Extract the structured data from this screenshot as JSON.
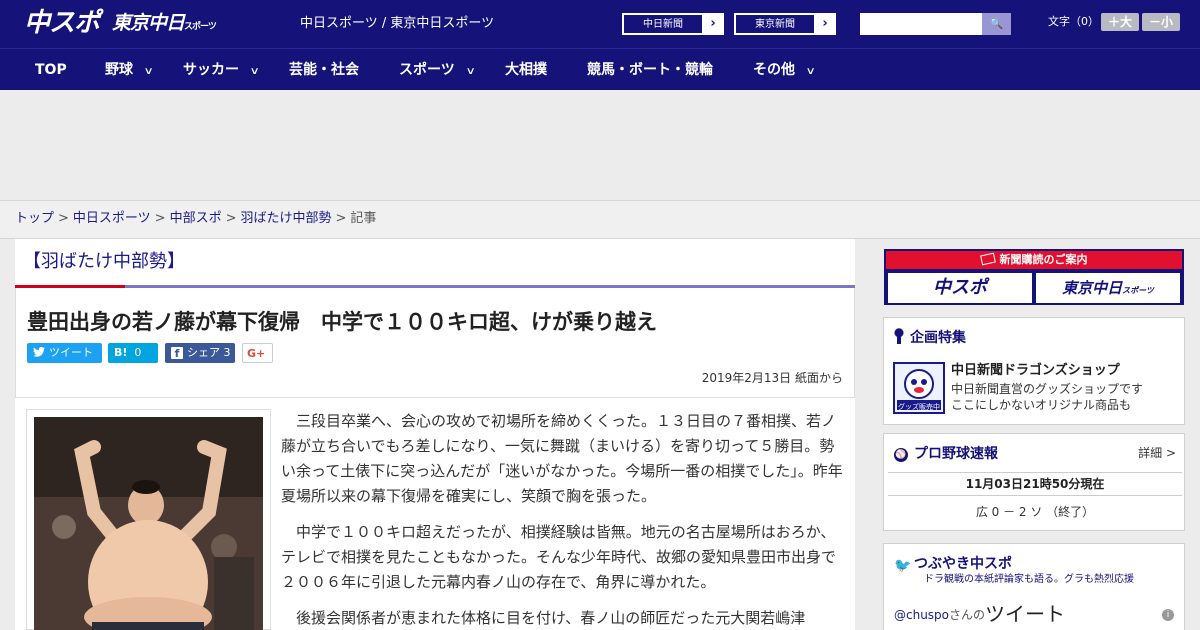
{
  "header": {
    "logo_main": "中スポ",
    "logo_tokyo": "東京中日",
    "logo_tokyo_small": "スポーツ",
    "site_link": "中日スポーツ / 東京中日スポーツ",
    "paper_buttons": [
      {
        "label": "中日新聞",
        "arrow": "›"
      },
      {
        "label": "東京新聞",
        "arrow": "›"
      }
    ],
    "search": {
      "value": "",
      "placeholder": "",
      "button_glyph": "🔍"
    },
    "font_size_label": "文字（0）",
    "font_bigger": "＋大",
    "font_smaller": "－小",
    "colors": {
      "header_bg": "#15137a",
      "accent_red": "#d0021b",
      "link": "#1a1a8c"
    }
  },
  "nav": {
    "items": [
      {
        "label": "TOP",
        "has_menu": false
      },
      {
        "label": "野球",
        "has_menu": true
      },
      {
        "label": "サッカー",
        "has_menu": true
      },
      {
        "label": "芸能・社会",
        "has_menu": false
      },
      {
        "label": "スポーツ",
        "has_menu": true
      },
      {
        "label": "大相撲",
        "has_menu": false
      },
      {
        "label": "競馬・ボート・競輪",
        "has_menu": false
      },
      {
        "label": "その他",
        "has_menu": true
      }
    ],
    "chevron": "∨"
  },
  "breadcrumb": {
    "items": [
      "トップ",
      "中日スポーツ",
      "中部スポ",
      "羽ばたけ中部勢"
    ],
    "current": "記事",
    "separator": ">"
  },
  "article": {
    "section": "【羽ばたけ中部勢】",
    "headline": "豊田出身の若ノ藤が幕下復帰　中学で１００キロ超、けが乗り越え",
    "share": {
      "tweet": "ツイート",
      "hatena_glyph": "B!",
      "hatena_count": "0",
      "facebook": "シェア",
      "facebook_count": "3",
      "gplus": "G+"
    },
    "dateline": "2019年2月13日 紙面から",
    "paragraphs": [
      "三段目卒業へ、会心の攻めで初場所を締めくくった。１３日目の７番相撲、若ノ藤が立ち合いでもろ差しになり、一気に舞蹴（まいける）を寄り切って５勝目。勢い余って土俵下に突っ込んだが「迷いがなかった。今場所一番の相撲でした」。昨年夏場所以来の幕下復帰を確実にし、笑顔で胸を張った。",
      "中学で１００キロ超えだったが、相撲経験は皆無。地元の名古屋場所はおろか、テレビで相撲を見たこともなかった。そんな少年時代、故郷の愛知県豊田市出身で２００６年に引退した元幕内春ノ山の存在で、角界に導かれた。",
      "後援会関係者が恵まれた体格に目を付け、春ノ山の師匠だった元大関若嶋津"
    ]
  },
  "sidebar": {
    "promo": {
      "header": "新聞購読のご案内",
      "left": "中スポ",
      "right": "東京中日",
      "right_small": "スポーツ"
    },
    "feature": {
      "heading": "企画特集",
      "ad_caption": "グッズ販売中",
      "title": "中日新聞ドラゴンズショップ",
      "desc1": "中日新聞直営のグッズショップです",
      "desc2": "ここにしかないオリジナル商品も"
    },
    "baseball": {
      "heading": "プロ野球速報",
      "detail": "詳細 >",
      "timestamp": "11月03日21時50分現在",
      "score": "広 0 － 2 ソ （終了）"
    },
    "tweets": {
      "heading": "つぶやき中スポ",
      "sub": "ドラ観戦の本紙評論家も語る。グラも熱烈応援",
      "handle": "@chuspo",
      "handle_suffix": "さんの",
      "title": "ツイート",
      "info_glyph": "i"
    }
  }
}
